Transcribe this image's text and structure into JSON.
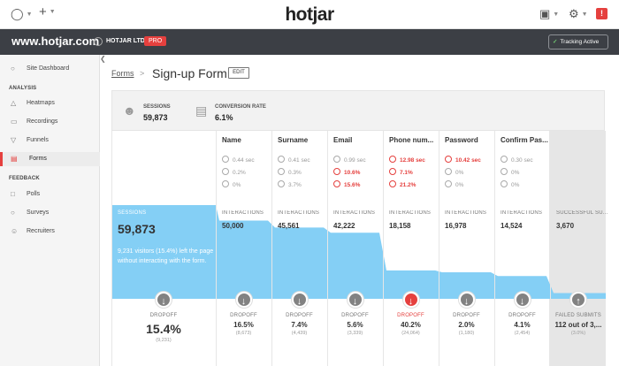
{
  "topbar": {
    "globe_icon": "globe-icon",
    "add_icon": "plus-icon",
    "logo_text": "hotjar",
    "notice_badge": "!"
  },
  "sitebar": {
    "site_name": "www.hotjar.com",
    "org_name": "HOTJAR LTD",
    "plan_badge": "PRO",
    "tracking_label": "Tracking Active"
  },
  "sidebar": {
    "items_top": [
      {
        "label": "Site Dashboard",
        "icon": "dashboard-icon"
      }
    ],
    "sections": [
      {
        "title": "ANALYSIS",
        "items": [
          {
            "label": "Heatmaps",
            "icon": "flame-icon"
          },
          {
            "label": "Recordings",
            "icon": "video-icon"
          },
          {
            "label": "Funnels",
            "icon": "funnel-icon"
          },
          {
            "label": "Forms",
            "icon": "form-icon",
            "active": true
          }
        ]
      },
      {
        "title": "FEEDBACK",
        "items": [
          {
            "label": "Polls",
            "icon": "poll-icon"
          },
          {
            "label": "Surveys",
            "icon": "survey-icon"
          },
          {
            "label": "Recruiters",
            "icon": "recruiter-icon"
          }
        ]
      }
    ]
  },
  "breadcrumb": {
    "parent": "Forms",
    "separator": ">"
  },
  "page": {
    "title": "Sign-up Form",
    "edit_label": "EDIT"
  },
  "summary": {
    "sessions_label": "SESSIONS",
    "sessions_value": "59,873",
    "conversion_label": "CONVERSION RATE",
    "conversion_value": "6.1%"
  },
  "funnel": {
    "sessions_col_label": "SESSIONS",
    "sessions_value": "59,873",
    "sessions_desc": "9,231 visitors (15.4%) left the page without interacting with the form.",
    "session_drop": {
      "label": "DROPOFF",
      "pct": "15.4%",
      "count": "(9,231)"
    },
    "fields": [
      {
        "name": "Name",
        "time": "0.44 sec",
        "refill": "0.2%",
        "blank": "0%",
        "interactions_label": "INTERACTIONS",
        "interactions": 50000,
        "interactions_text": "50,000",
        "drop_label": "DROPOFF",
        "drop_pct": "16.5%",
        "drop_count": "(8,673)"
      },
      {
        "name": "Surname",
        "time": "0.41 sec",
        "refill": "0.3%",
        "blank": "3.7%",
        "interactions_label": "INTERACTIONS",
        "interactions": 45561,
        "interactions_text": "45,561",
        "drop_label": "DROPOFF",
        "drop_pct": "7.4%",
        "drop_count": "(4,439)"
      },
      {
        "name": "Email",
        "time": "0.99 sec",
        "refill": "10.6%",
        "blank": "15.6%",
        "refill_red": true,
        "blank_red": true,
        "interactions_label": "INTERACTIONS",
        "interactions": 42222,
        "interactions_text": "42,222",
        "drop_label": "DROPOFF",
        "drop_pct": "5.6%",
        "drop_count": "(3,339)"
      },
      {
        "name": "Phone num...",
        "time": "12.98 sec",
        "refill": "7.1%",
        "blank": "21.2%",
        "time_red": true,
        "refill_red": true,
        "blank_red": true,
        "interactions_label": "INTERACTIONS",
        "interactions": 18158,
        "interactions_text": "18,158",
        "drop_label": "DROPOFF",
        "drop_pct": "40.2%",
        "drop_count": "(24,064)",
        "drop_red": true
      },
      {
        "name": "Password",
        "time": "10.42 sec",
        "refill": "0%",
        "blank": "0%",
        "time_red": true,
        "interactions_label": "INTERACTIONS",
        "interactions": 16978,
        "interactions_text": "16,978",
        "drop_label": "DROPOFF",
        "drop_pct": "2.0%",
        "drop_count": "(1,180)"
      },
      {
        "name": "Confirm Pas...",
        "time": "0.30 sec",
        "refill": "0%",
        "blank": "0%",
        "interactions_label": "INTERACTIONS",
        "interactions": 14524,
        "interactions_text": "14,524",
        "drop_label": "DROPOFF",
        "drop_pct": "4.1%",
        "drop_count": "(2,454)"
      }
    ],
    "failed": {
      "label": "SUCCESSFUL SU...",
      "value": 3670,
      "value_text": "3,670",
      "drop_label": "FAILED SUBMITS",
      "drop_text": "112 out of 3,...",
      "drop_sub": "(3.0%)"
    },
    "colors": {
      "fill": "#84cff5",
      "red": "#e5403e",
      "grey": "#828282"
    }
  }
}
